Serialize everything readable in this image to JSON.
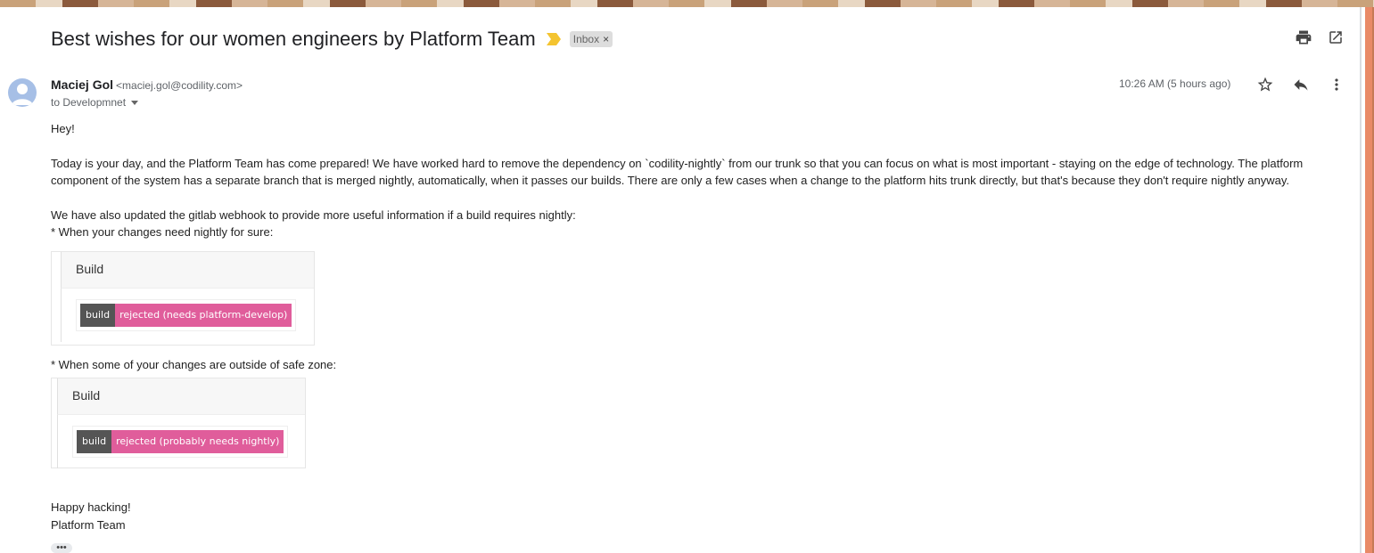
{
  "email": {
    "subject": "Best wishes for our women engineers by Platform Team",
    "label": "Inbox",
    "label_close": "×",
    "sender_name": "Maciej Gol",
    "sender_email": "<maciej.gol@codility.com>",
    "to": "to Developmnet",
    "time": "10:26 AM (5 hours ago)",
    "icons": {
      "print": "print-icon",
      "new_window": "open-in-new-window-icon",
      "star": "star-icon",
      "reply": "reply-icon",
      "more": "more-vert-icon",
      "important": "importance-marker-icon",
      "avatar": "avatar-icon"
    },
    "colors": {
      "importance": "#f4c430",
      "badge_left": "#555555",
      "badge_right": "#e05d9b"
    }
  },
  "body": {
    "greeting": "Hey!",
    "para1_line1": "Today is your day, and the Platform Team has come prepared! We have worked hard to remove the dependency on `codility-nightly` from our trunk so that you can focus on what is most important - staying on the edge of technology. The platform",
    "para1_line2": "component of the system has a separate branch that is merged nightly, automatically, when it passes our builds. There are only a few cases when a change to the platform hits trunk directly, but that's because they don't require nightly anyway.",
    "para2_line1": "We have also updated the gitlab webhook to provide more useful information if a build requires nightly:",
    "bullet1": "* When your changes need nightly for sure:",
    "card1": {
      "title": "Build",
      "badge_left": "build",
      "badge_right": "rejected (needs platform-develop)"
    },
    "bullet2": "* When some of your changes are outside of safe zone:",
    "card2": {
      "title": "Build",
      "badge_left": "build",
      "badge_right": "rejected (probably needs nightly)"
    },
    "closing1": "Happy hacking!",
    "closing2": "Platform Team",
    "ellipsis": "•••"
  }
}
